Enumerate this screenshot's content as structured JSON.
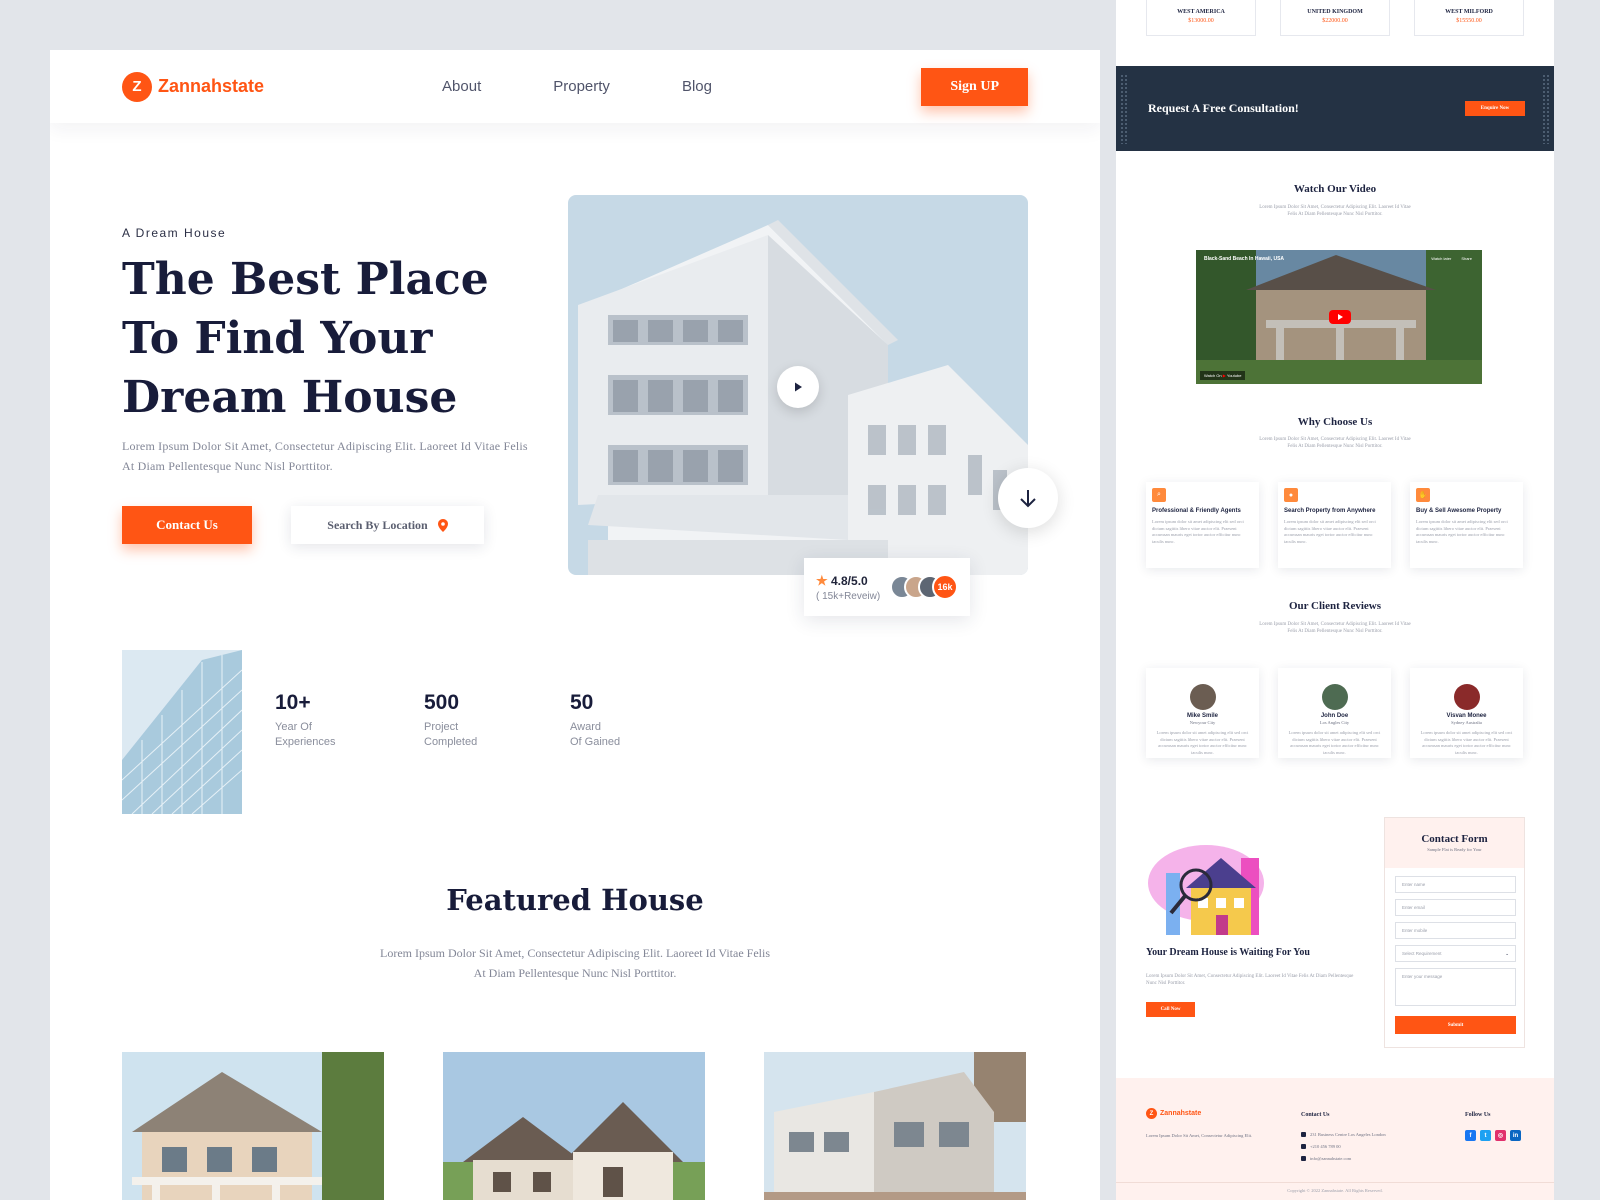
{
  "brand": {
    "name": "Zannahstate",
    "mark": "Z"
  },
  "nav": {
    "items": [
      "About",
      "Property",
      "Blog"
    ],
    "signup": "Sign UP"
  },
  "hero": {
    "eyebrow": "A Dream House",
    "title": "The Best Place To Find Your Dream House",
    "description": "Lorem Ipsum Dolor Sit Amet, Consectetur Adipiscing Elit. Laoreet Id Vitae Felis At Diam Pellentesque Nunc Nisl Porttitor.",
    "contact_button": "Contact Us",
    "search_button": "Search By Location"
  },
  "rating": {
    "score": "4.8/5.0",
    "reviews": "( 15k+Reveiw)",
    "count_badge": "16k"
  },
  "stats": [
    {
      "value": "10+",
      "label": "Year Of\nExperiences"
    },
    {
      "value": "500",
      "label": "Project\nCompleted"
    },
    {
      "value": "50",
      "label": "Award\nOf Gained"
    }
  ],
  "featured": {
    "title": "Featured House",
    "description": "Lorem Ipsum Dolor Sit Amet, Consectetur Adipiscing Elit. Laoreet Id Vitae Felis At Diam Pellentesque Nunc Nisl Porttitor."
  },
  "locations": [
    {
      "name": "WEST AMERICA",
      "price": "$13000.00"
    },
    {
      "name": "UNITED KINGDOM",
      "price": "$22000.00"
    },
    {
      "name": "WEST MILFORD",
      "price": "$15550.00"
    }
  ],
  "cta": {
    "text": "Request A Free Consultation!",
    "button": "Enquire Now"
  },
  "video_section": {
    "title": "Watch Our Video",
    "description": "Lorem Ipsum Dolor Sit Amet, Consectetur Adipiscing Elit. Laoreet Id Vitae Felis At Diam Pellentesque Nunc Nisl Porttitor.",
    "caption": "Black-Sand Beach In Hawaii, USA",
    "watch_later": "Watch later",
    "share": "Share",
    "watch_on": "Watch On",
    "platform": "Youtube"
  },
  "why": {
    "title": "Why Choose Us",
    "description": "Lorem Ipsum Dolor Sit Amet, Consectetur Adipiscing Elit. Laoreet Id Vitae Felis At Diam Pellentesque Nunc Nisl Porttitor.",
    "cards": [
      {
        "title": "Professional & Friendly Agents",
        "text": "Lorem ipsum dolor sit amet adipiscing elit sed orci dictum sagittis libero vitae auctor elit. Praesent accumsan mauris eget tortor auctor efficitur nunc iaculis nunc."
      },
      {
        "title": "Search Property from Anywhere",
        "text": "Lorem ipsum dolor sit amet adipiscing elit sed orci dictum sagittis libero vitae auctor elit. Praesent accumsan mauris eget tortor auctor efficitur nunc iaculis nunc."
      },
      {
        "title": "Buy & Sell Awesome Property",
        "text": "Lorem ipsum dolor sit amet adipiscing elit sed orci dictum sagittis libero vitae auctor elit. Praesent accumsan mauris eget tortor auctor efficitur nunc iaculis nunc."
      }
    ]
  },
  "reviews": {
    "title": "Our Client Reviews",
    "description": "Lorem Ipsum Dolor Sit Amet, Consectetur Adipiscing Elit. Laoreet Id Vitae Felis At Diam Pellentesque Nunc Nisl Porttitor.",
    "cards": [
      {
        "name": "Mike Smile",
        "city": "Newyour City",
        "text": "Lorem ipsum dolor sit amet adipiscing elit sed orci dictum sagittis libero vitae auctor elit. Praesent accumsan mauris eget tortor auctor efficitur nunc iaculis nunc."
      },
      {
        "name": "John Doe",
        "city": "Los Angles City",
        "text": "Lorem ipsum dolor sit amet adipiscing elit sed orci dictum sagittis libero vitae auctor elit. Praesent accumsan mauris eget tortor auctor efficitur nunc iaculis nunc."
      },
      {
        "name": "Visvan Monee",
        "city": "Sydney Australia",
        "text": "Lorem ipsum dolor sit amet adipiscing elit sed orci dictum sagittis libero vitae auctor elit. Praesent accumsan mauris eget tortor auctor efficitur nunc iaculis nunc."
      }
    ]
  },
  "dream": {
    "title": "Your Dream House is Waiting For You",
    "description": "Lorem Ipsum Dolor Sit Amet, Consectetur Adipiscing Elit. Laoreet Id Vitae Felis At Diam Pellentesque Nunc Nisl Porttitor.",
    "button": "Call Now"
  },
  "contact_form": {
    "title": "Contact Form",
    "subtitle": "Sample Flat is Ready for Your",
    "name_placeholder": "Enter name",
    "email_placeholder": "Enter email",
    "mobile_placeholder": "Enter mobile",
    "requirement_value": "Select Requirement",
    "message_placeholder": "Enter your message",
    "submit": "Submit"
  },
  "footer": {
    "description": "Lorem Ipsum Dolor Sit Amet, Consectetur Adipiscing Elit.",
    "contact_heading": "Contact Us",
    "address": "231 Business Centre Los Angeles London",
    "phone": "+210 456 789 00",
    "email": "info@zannahstate.com",
    "follow_heading": "Follow Us",
    "copyright": "Copyright © 2022 Zannahstate. All Rights Reserved."
  },
  "colors": {
    "accent": "#ff5514",
    "dark_band": "#243244",
    "heading": "#181c3a"
  }
}
